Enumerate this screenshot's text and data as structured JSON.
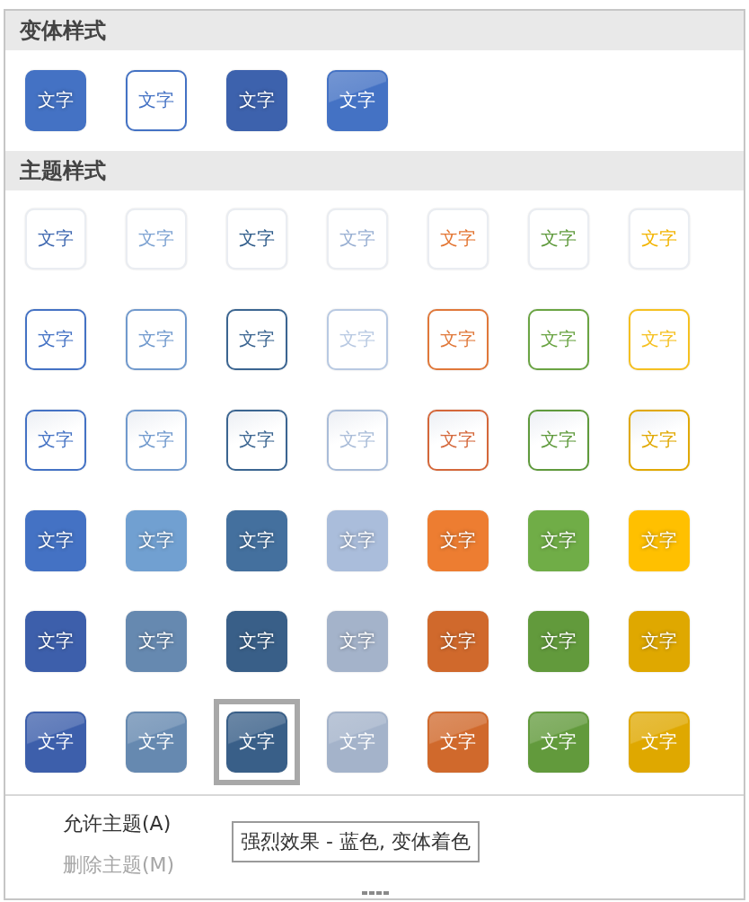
{
  "variant_styles": {
    "title": "变体样式",
    "tiles": [
      {
        "kind": "solid",
        "color": "#4472c4",
        "label": "文字",
        "selected": false
      },
      {
        "kind": "outline",
        "color": "#4472c4",
        "label": "文字",
        "selected": false
      },
      {
        "kind": "solid",
        "color": "#3d62ad",
        "label": "文字",
        "selected": false
      },
      {
        "kind": "intense",
        "color": "#4472c4",
        "label": "文字",
        "selected": false
      }
    ]
  },
  "theme_styles": {
    "title": "主题样式",
    "rows": [
      {
        "kind": "subtle",
        "tiles": [
          {
            "color": "#3f68b0",
            "label": "文字",
            "selected": false
          },
          {
            "color": "#7ea3d2",
            "label": "文字",
            "selected": false
          },
          {
            "color": "#2f5c8a",
            "label": "文字",
            "selected": false
          },
          {
            "color": "#98afd2",
            "label": "文字",
            "selected": false
          },
          {
            "color": "#e37532",
            "label": "文字",
            "selected": false
          },
          {
            "color": "#5f9a3c",
            "label": "文字",
            "selected": false
          },
          {
            "color": "#f2b400",
            "label": "文字",
            "selected": false
          }
        ]
      },
      {
        "kind": "outline",
        "tiles": [
          {
            "color": "#4472c4",
            "label": "文字",
            "selected": false
          },
          {
            "color": "#7099cd",
            "label": "文字",
            "selected": false
          },
          {
            "color": "#3b6591",
            "label": "文字",
            "selected": false
          },
          {
            "color": "#b8c9e2",
            "label": "文字",
            "selected": false
          },
          {
            "color": "#e0783a",
            "label": "文字",
            "selected": false
          },
          {
            "color": "#6aa443",
            "label": "文字",
            "selected": false
          },
          {
            "color": "#f5c020",
            "label": "文字",
            "selected": false
          }
        ]
      },
      {
        "kind": "light",
        "tiles": [
          {
            "color": "#4472c4",
            "label": "文字",
            "selected": false
          },
          {
            "color": "#7099cd",
            "label": "文字",
            "selected": false
          },
          {
            "color": "#3b6591",
            "label": "文字",
            "selected": false
          },
          {
            "color": "#a9bcd8",
            "label": "文字",
            "selected": false
          },
          {
            "color": "#d4673a",
            "label": "文字",
            "selected": false
          },
          {
            "color": "#5f9a3c",
            "label": "文字",
            "selected": false
          },
          {
            "color": "#e0a800",
            "label": "文字",
            "selected": false
          }
        ]
      },
      {
        "kind": "solid",
        "tiles": [
          {
            "color": "#4472c4",
            "label": "文字",
            "selected": false
          },
          {
            "color": "#71a0d1",
            "label": "文字",
            "selected": false
          },
          {
            "color": "#44709e",
            "label": "文字",
            "selected": false
          },
          {
            "color": "#aabddb",
            "label": "文字",
            "selected": false
          },
          {
            "color": "#ed7d31",
            "label": "文字",
            "selected": false
          },
          {
            "color": "#70ad47",
            "label": "文字",
            "selected": false
          },
          {
            "color": "#ffc000",
            "label": "文字",
            "selected": false
          }
        ]
      },
      {
        "kind": "solid",
        "tiles": [
          {
            "color": "#3d5fab",
            "label": "文字",
            "selected": false
          },
          {
            "color": "#6689b0",
            "label": "文字",
            "selected": false
          },
          {
            "color": "#395f88",
            "label": "文字",
            "selected": false
          },
          {
            "color": "#a4b3ca",
            "label": "文字",
            "selected": false
          },
          {
            "color": "#d0692c",
            "label": "文字",
            "selected": false
          },
          {
            "color": "#629a3c",
            "label": "文字",
            "selected": false
          },
          {
            "color": "#dfa800",
            "label": "文字",
            "selected": false
          }
        ]
      },
      {
        "kind": "intense",
        "tiles": [
          {
            "color": "#3d5fab",
            "label": "文字",
            "selected": false
          },
          {
            "color": "#6689b0",
            "label": "文字",
            "selected": false
          },
          {
            "color": "#395f88",
            "label": "文字",
            "selected": true
          },
          {
            "color": "#a4b3ca",
            "label": "文字",
            "selected": false
          },
          {
            "color": "#d0692c",
            "label": "文字",
            "selected": false
          },
          {
            "color": "#629a3c",
            "label": "文字",
            "selected": false
          },
          {
            "color": "#dfa800",
            "label": "文字",
            "selected": false
          }
        ]
      }
    ]
  },
  "menu": [
    {
      "label": "允许主题(A)",
      "disabled": false
    },
    {
      "label": "删除主题(M)",
      "disabled": true
    }
  ],
  "tooltip": "强烈效果 - 蓝色, 变体着色"
}
